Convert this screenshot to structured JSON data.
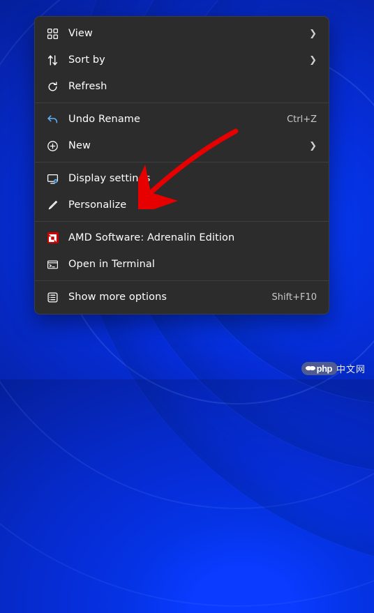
{
  "menu": {
    "groups": [
      [
        {
          "id": "view",
          "label": "View",
          "icon": "view-grid-icon",
          "submenu": true
        },
        {
          "id": "sort",
          "label": "Sort by",
          "icon": "sort-icon",
          "submenu": true
        },
        {
          "id": "refresh",
          "label": "Refresh",
          "icon": "refresh-icon"
        }
      ],
      [
        {
          "id": "undo",
          "label": "Undo Rename",
          "icon": "undo-icon",
          "accel": "Ctrl+Z"
        },
        {
          "id": "new",
          "label": "New",
          "icon": "new-icon",
          "submenu": true
        }
      ],
      [
        {
          "id": "display",
          "label": "Display settings",
          "icon": "display-icon"
        },
        {
          "id": "personalize",
          "label": "Personalize",
          "icon": "personalize-icon"
        }
      ],
      [
        {
          "id": "amd",
          "label": "AMD Software: Adrenalin Edition",
          "icon": "amd-icon"
        },
        {
          "id": "terminal",
          "label": "Open in Terminal",
          "icon": "terminal-icon"
        }
      ],
      [
        {
          "id": "more",
          "label": "Show more options",
          "icon": "more-options-icon",
          "accel": "Shift+F10"
        }
      ]
    ]
  },
  "annotation": {
    "arrow_target": "display"
  },
  "watermark": {
    "text_a": "php",
    "text_b": "中文网"
  }
}
